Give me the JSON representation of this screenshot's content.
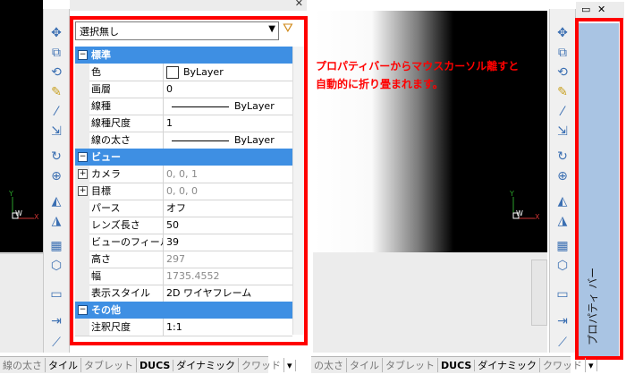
{
  "left": {
    "selector": {
      "value": "選択無し"
    },
    "categories": [
      {
        "label": "標準",
        "state": "⊟",
        "rows": [
          {
            "label": "色",
            "value": "ByLayer",
            "swatch": "#ffffff"
          },
          {
            "label": "画層",
            "value": "0"
          },
          {
            "label": "線種",
            "value": "ByLayer",
            "line": true
          },
          {
            "label": "線種尺度",
            "value": "1"
          },
          {
            "label": "線の太さ",
            "value": "ByLayer",
            "line": true
          }
        ]
      },
      {
        "label": "ビュー",
        "state": "⊟",
        "rows": [
          {
            "label": "カメラ",
            "value": "0, 0, 1",
            "expand": "⊞",
            "dim": true
          },
          {
            "label": "目標",
            "value": "0, 0, 0",
            "expand": "⊞",
            "dim": true
          },
          {
            "label": "パース",
            "value": "オフ"
          },
          {
            "label": "レンズ長さ",
            "value": "50"
          },
          {
            "label": "ビューのフィールド",
            "value": "39"
          },
          {
            "label": "高さ",
            "value": "297",
            "dim": true
          },
          {
            "label": "幅",
            "value": "1735.4552",
            "dim": true
          },
          {
            "label": "表示スタイル",
            "value": "2D ワイヤフレーム"
          }
        ]
      },
      {
        "label": "その他",
        "state": "⊟",
        "rows": [
          {
            "label": "注釈尺度",
            "value": "1:1"
          }
        ]
      }
    ],
    "statusbar": [
      {
        "label": "線の太さ",
        "on": false
      },
      {
        "label": "タイル",
        "on": true
      },
      {
        "label": "タブレット",
        "on": false
      },
      {
        "label": "DUCS",
        "on": true,
        "bold": true
      },
      {
        "label": "ダイナミック",
        "on": true
      },
      {
        "label": "クワッド",
        "on": false
      },
      {
        "label": "▾",
        "on": true
      }
    ]
  },
  "right": {
    "note": [
      "プロパティバーからマウスカーソル離すと",
      "自動的に折り畳まれます。"
    ],
    "collapsed_label": "プロパティ バー",
    "statusbar": [
      {
        "label": "の太さ",
        "on": false
      },
      {
        "label": "タイル",
        "on": false
      },
      {
        "label": "タブレット",
        "on": false
      },
      {
        "label": "DUCS",
        "on": true,
        "bold": true
      },
      {
        "label": "ダイナミック",
        "on": true
      },
      {
        "label": "クワッド",
        "on": false
      },
      {
        "label": "▾",
        "on": true
      }
    ]
  },
  "ucs": {
    "x": "X",
    "y": "Y",
    "w": "W"
  },
  "colors": {
    "highlight": "#ff0000",
    "category": "#3e8fe3",
    "collapsed_bar": "#a9c4e3"
  },
  "icons": [
    "move-icon",
    "copy-icon",
    "rotate-icon",
    "matchprop-icon",
    "eyedropper-icon",
    "scale-icon",
    "refresh-icon",
    "orbit-icon",
    "mirror-icon",
    "mirror2-icon",
    "grid-icon",
    "cube-icon",
    "align-icon",
    "stretch-icon",
    "line-icon"
  ]
}
